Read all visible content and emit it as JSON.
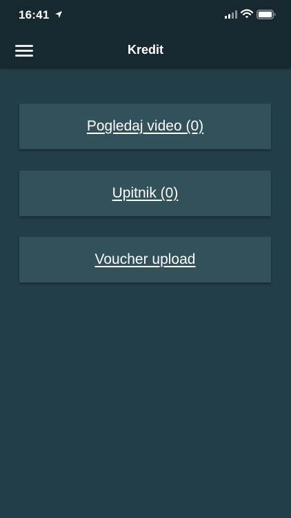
{
  "status_bar": {
    "time": "16:41",
    "icons": [
      "location-arrow-icon",
      "signal-icon",
      "wifi-icon",
      "battery-icon"
    ]
  },
  "header": {
    "title": "Kredit",
    "menu_icon": "hamburger-menu-icon"
  },
  "actions": [
    {
      "label": "Pogledaj video (0)"
    },
    {
      "label": "Upitnik (0)"
    },
    {
      "label": "Voucher upload"
    }
  ],
  "colors": {
    "header_bg": "#17282e",
    "page_bg": "#223e48",
    "card_bg": "#33515b",
    "text": "#ffffff"
  }
}
